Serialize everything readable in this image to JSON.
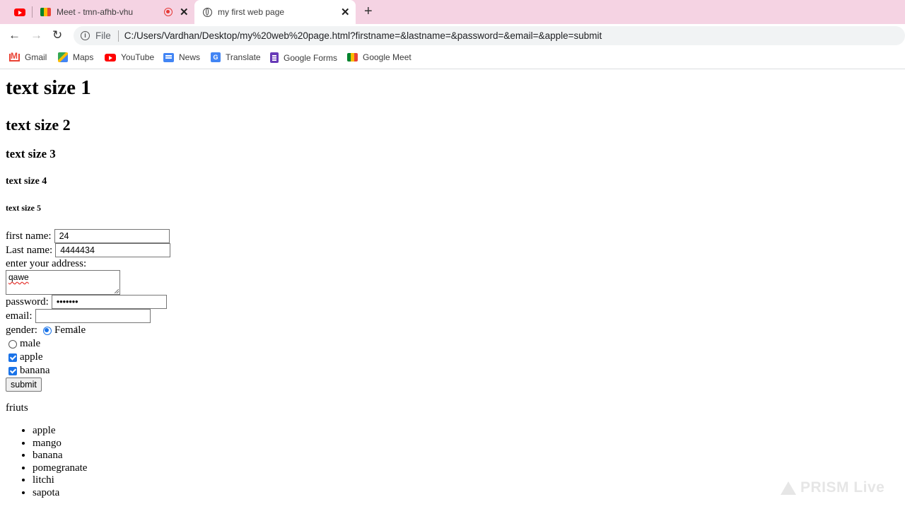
{
  "browser": {
    "tabs": [
      {
        "title": "",
        "icon": "youtube-icon"
      },
      {
        "title": "Meet - tmn-afhb-vhu",
        "icon": "google-meet-icon",
        "recording": true
      },
      {
        "title": "my first web page",
        "icon": "globe-icon",
        "active": true
      }
    ],
    "url_scheme": "File",
    "url": "C:/Users/Vardhan/Desktop/my%20web%20page.html?firstname=&lastname=&password=&email=&apple=submit",
    "bookmarks": [
      {
        "label": "Gmail",
        "icon": "gmail-icon"
      },
      {
        "label": "Maps",
        "icon": "maps-icon"
      },
      {
        "label": "YouTube",
        "icon": "youtube-icon"
      },
      {
        "label": "News",
        "icon": "news-icon"
      },
      {
        "label": "Translate",
        "icon": "translate-icon"
      },
      {
        "label": "Google Forms",
        "icon": "google-forms-icon"
      },
      {
        "label": "Google Meet",
        "icon": "google-meet-icon"
      }
    ],
    "accent": "#f5d3e3"
  },
  "page": {
    "headings": [
      "text size 1",
      "text size 2",
      "text size 3",
      "text size 4",
      "text size 5"
    ],
    "form": {
      "first_name_label": "first name:",
      "first_name_value": "24",
      "last_name_label": "Last name:",
      "last_name_value": "4444434",
      "address_label": "enter your address:",
      "address_value": "qawe",
      "password_label": "password:",
      "password_value": "•••••••",
      "email_label": "email:",
      "email_value": "",
      "gender_label": "gender:",
      "gender_options": [
        {
          "label": "Female",
          "selected": true
        },
        {
          "label": "male",
          "selected": false
        }
      ],
      "checkboxes": [
        {
          "label": "apple",
          "checked": true
        },
        {
          "label": "banana",
          "checked": true
        }
      ],
      "submit_label": "submit"
    },
    "list_title": "friuts",
    "fruits": [
      "apple",
      "mango",
      "banana",
      "pomegranate",
      "litchi",
      "sapota"
    ]
  },
  "watermark": "PRISM Live"
}
